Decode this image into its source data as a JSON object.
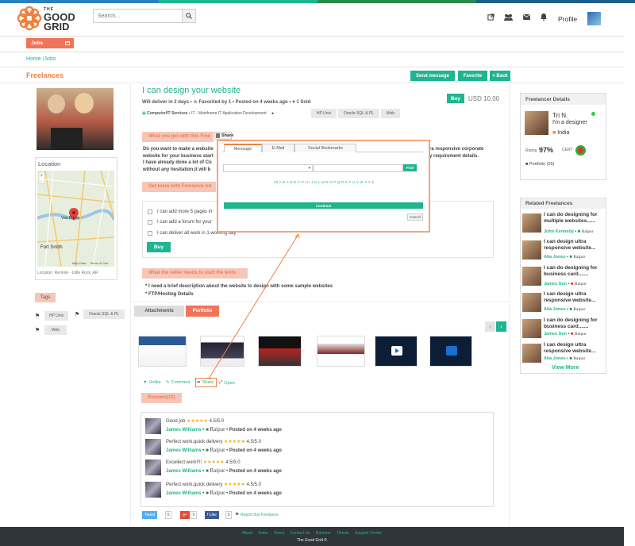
{
  "colors": {
    "accent": "#1eb58f",
    "orange": "#f0745a",
    "topbar": [
      "#2c7fc1",
      "#1eb58f",
      "#2a8a4a",
      "#1a5f8a"
    ]
  },
  "header": {
    "logo_text": [
      "THE",
      "GOOD",
      "GRID"
    ],
    "search_placeholder": "Search...",
    "profile_label": "Profile"
  },
  "nav": {
    "jobs_label": "Jobs",
    "breadcrumb": "Home /Jobs"
  },
  "page": {
    "section_title": "Freelances",
    "send_message": "Send message",
    "favorite": "Favorite",
    "back": "< Back"
  },
  "left": {
    "location_title": "Location",
    "map_city1": "Van Buren",
    "map_city2": "Fort Smith",
    "map_data": "Map Data",
    "map_terms": "Terms of Use",
    "location_line": "Location: Remote - Little Rock, AR",
    "tags_label": "Tags",
    "tags": [
      "HP Unix",
      "Oracle SQL & PL",
      "Web"
    ]
  },
  "gig": {
    "title": "I can design your website",
    "deliver": "Will deliver in 2 days",
    "favorited": "Favorited by 1",
    "posted": "Posted on 4 weeks ago",
    "sold": "1 Sold",
    "category": "Computer/IT Services",
    "subcategory": "IT - Mainframe  IT Application Development",
    "cat_tags": [
      "HP Unix",
      "Oracle SQL & PL",
      "Web"
    ],
    "buy_label": "Buy",
    "price": "USD 10.00",
    "what_you_get": "What you get with this Free",
    "desc_lines": [
      "Do you want to make a website",
      "website for your business start",
      "I have already done a lot of Co",
      "without any hesitation,it will b"
    ],
    "desc_right_lines": [
      "ra responsive corporate",
      "y requirement details."
    ],
    "get_more": "Get more with Freelance Ad",
    "addons": [
      "I can add more 5 pages in",
      "I can add a forum for your",
      "I can deliver all work in 1 working day"
    ],
    "buy2_label": "Buy",
    "needs_title": "What the seller needs to start the work",
    "needs": [
      "* I need a brief description about the website to design with some sample websites",
      "* FTP/Hosting Details"
    ],
    "tab_attachments": "Attachments",
    "tab_portfolio": "Portfolio",
    "actions": {
      "unlike": "Unlike",
      "comment": "Comment",
      "share": "Share",
      "open": "Open"
    },
    "reviews_label": "Reviews(12)",
    "reviews": [
      {
        "title": "Good job",
        "rating": "4.5/5.0",
        "user": "James Williams",
        "city": "Raipur",
        "posted": "Posted on 4 weeks ago"
      },
      {
        "title": "Perfect work,quick delivery",
        "rating": "4.5/5.0",
        "user": "James Williams",
        "city": "Raipur",
        "posted": "Posted on 4 weeks ago"
      },
      {
        "title": "Excellect work!!!!",
        "rating": "4.5/5.0",
        "user": "James Williams",
        "city": "Raipur",
        "posted": "Posted on 4 weeks ago"
      },
      {
        "title": "Perfect work,quick delivery",
        "rating": "4.5/5.0",
        "user": "James Williams",
        "city": "Raipur",
        "posted": "Posted on 4 weeks ago"
      }
    ],
    "social": {
      "tweet": "Tweet",
      "tweet_n": "0",
      "gplus": "g+",
      "gplus_n": "0",
      "flike": "f Like",
      "flike_n": "0",
      "report": "Report this Freelance"
    }
  },
  "share_modal": {
    "header": "Share",
    "tabs": [
      "Message",
      "E-Mail",
      "Social Bookmarks"
    ],
    "find": "Find",
    "alphabet": "All A B C D E F G H I J K L M N O P Q R S T U V W X Y Z",
    "continue": "Continue",
    "cancel": "Cancel"
  },
  "right": {
    "details_title": "Freelancer Details",
    "name": "Tri N.",
    "role": "I'm a designer",
    "country": "India",
    "rating_label": "Rating",
    "rating": "97%",
    "cert_label": "CERT",
    "portfolio": "Portfolio (26)",
    "related_title": "Related Freelances",
    "related": [
      {
        "title": "I can do designing for multiple websites......",
        "user": "John Kennedy",
        "city": "Raipur"
      },
      {
        "title": "I can design ultra responsive website...",
        "user": "Alia Jones",
        "city": "Raipur"
      },
      {
        "title": "I can do designing for business card.......",
        "user": "James Son",
        "city": "Raipur"
      },
      {
        "title": "I can design ultra responsive website...",
        "user": "Alia Jones",
        "city": "Raipur"
      },
      {
        "title": "I can do designing for business card.......",
        "user": "James Son",
        "city": "Raipur"
      },
      {
        "title": "I can design ultra responsive website...",
        "user": "Alia Jones",
        "city": "Raipur"
      }
    ],
    "view_more": "View More"
  },
  "footer": {
    "links": [
      "About",
      "Invite",
      "Terms",
      "Contact Us",
      "Banners",
      "Tickets",
      "Support Center"
    ],
    "copyright": "The Good Grid ©"
  }
}
